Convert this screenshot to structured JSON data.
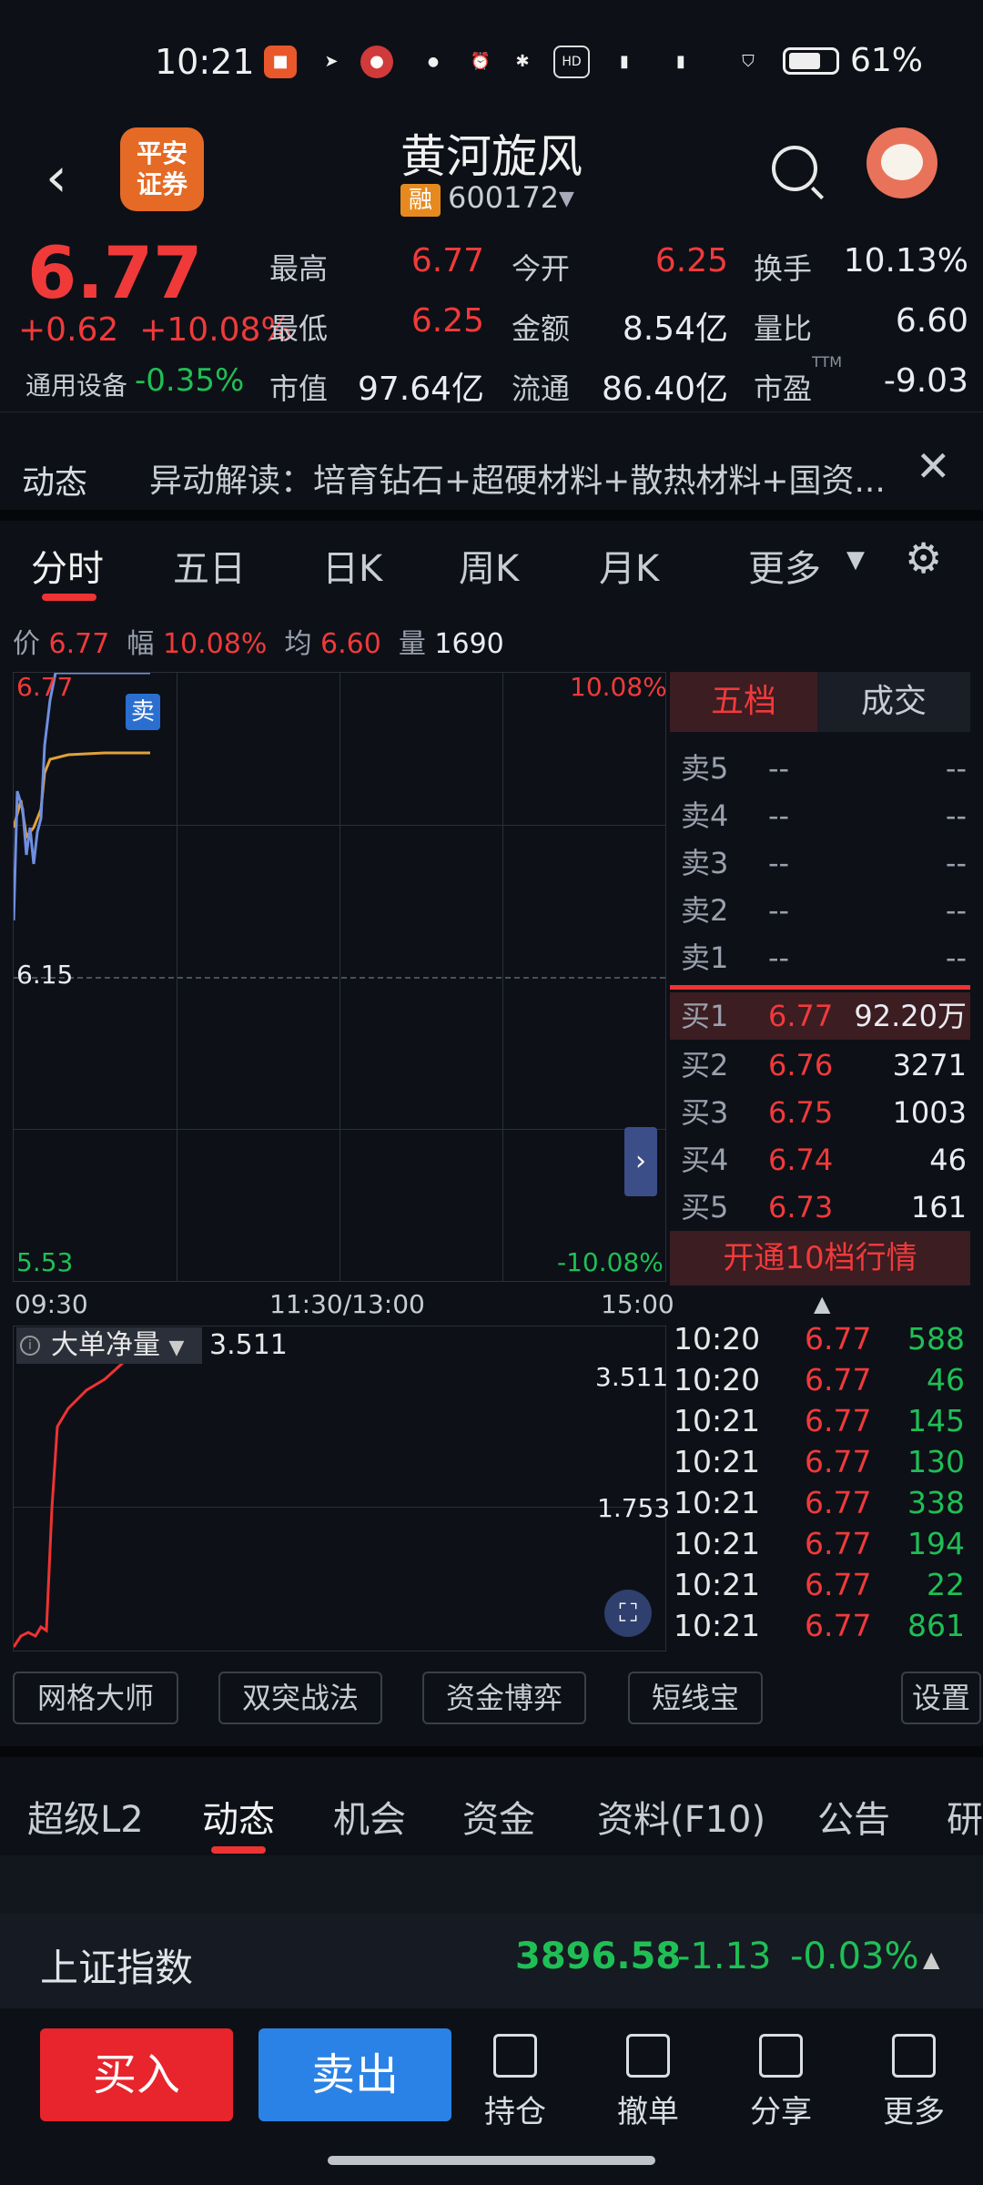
{
  "status_bar": {
    "time": "10:21",
    "battery": "61%"
  },
  "header": {
    "logo_text": "平安证券",
    "stock_name": "黄河旋风",
    "margin_badge": "融",
    "stock_code": "600172"
  },
  "quote": {
    "price": "6.77",
    "change": "+0.62",
    "change_pct": "+10.08%",
    "industry": "通用设备",
    "industry_chg": "-0.35%",
    "fields": [
      {
        "label": "最高",
        "value": "6.77",
        "color": "red"
      },
      {
        "label": "今开",
        "value": "6.25",
        "color": "red"
      },
      {
        "label": "换手",
        "value": "10.13%",
        "color": "white"
      },
      {
        "label": "最低",
        "value": "6.25",
        "color": "red"
      },
      {
        "label": "金额",
        "value": "8.54亿",
        "color": "white"
      },
      {
        "label": "量比",
        "value": "6.60",
        "color": "white"
      },
      {
        "label": "市值",
        "value": "97.64亿",
        "color": "white"
      },
      {
        "label": "流通",
        "value": "86.40亿",
        "color": "white"
      },
      {
        "label": "市盈",
        "value": "-9.03",
        "color": "white"
      }
    ],
    "ttm": "TTM"
  },
  "news": {
    "tag": "动态",
    "text": "异动解读：培育钻石+超硬材料+散热材料+国资..."
  },
  "kline_tabs": [
    "分时",
    "五日",
    "日K",
    "周K",
    "月K",
    "更多"
  ],
  "info_line": {
    "price_label": "价",
    "price": "6.77",
    "amp_label": "幅",
    "amp": "10.08%",
    "avg_label": "均",
    "avg": "6.60",
    "vol_label": "量",
    "vol": "1690"
  },
  "chart": {
    "y_top": "6.77",
    "y_mid": "6.15",
    "y_bottom": "5.53",
    "pct_top": "10.08%",
    "pct_bottom": "-10.08%",
    "sell_mark": "卖",
    "time_labels": [
      "09:30",
      "11:30/13:00",
      "15:00"
    ]
  },
  "order_book": {
    "tabs": [
      "五档",
      "成交"
    ],
    "asks": [
      {
        "label": "卖5",
        "price": "--",
        "vol": "--"
      },
      {
        "label": "卖4",
        "price": "--",
        "vol": "--"
      },
      {
        "label": "卖3",
        "price": "--",
        "vol": "--"
      },
      {
        "label": "卖2",
        "price": "--",
        "vol": "--"
      },
      {
        "label": "卖1",
        "price": "--",
        "vol": "--"
      }
    ],
    "bids": [
      {
        "label": "买1",
        "price": "6.77",
        "vol": "92.20万"
      },
      {
        "label": "买2",
        "price": "6.76",
        "vol": "3271"
      },
      {
        "label": "买3",
        "price": "6.75",
        "vol": "1003"
      },
      {
        "label": "买4",
        "price": "6.74",
        "vol": "46"
      },
      {
        "label": "买5",
        "price": "6.73",
        "vol": "161"
      }
    ],
    "level10": "开通10档行情"
  },
  "big_order": {
    "label": "大单净量",
    "value": "3.511",
    "y_top": "3.511",
    "y_mid": "1.753"
  },
  "trades": [
    {
      "time": "10:20",
      "price": "6.77",
      "vol": "588"
    },
    {
      "time": "10:20",
      "price": "6.77",
      "vol": "46"
    },
    {
      "time": "10:21",
      "price": "6.77",
      "vol": "145"
    },
    {
      "time": "10:21",
      "price": "6.77",
      "vol": "130"
    },
    {
      "time": "10:21",
      "price": "6.77",
      "vol": "338"
    },
    {
      "time": "10:21",
      "price": "6.77",
      "vol": "194"
    },
    {
      "time": "10:21",
      "price": "6.77",
      "vol": "22"
    },
    {
      "time": "10:21",
      "price": "6.77",
      "vol": "861"
    }
  ],
  "tools": [
    "网格大师",
    "双突战法",
    "资金博弈",
    "短线宝",
    "设置"
  ],
  "bottom_tabs": [
    "超级L2",
    "动态",
    "机会",
    "资金",
    "资料(F10)",
    "公告",
    "研"
  ],
  "index_bar": {
    "name": "上证指数",
    "value": "3896.58",
    "change": "-1.13",
    "pct": "-0.03%"
  },
  "actions": {
    "buy": "买入",
    "sell": "卖出",
    "items": [
      "持仓",
      "撤单",
      "分享",
      "更多"
    ]
  }
}
